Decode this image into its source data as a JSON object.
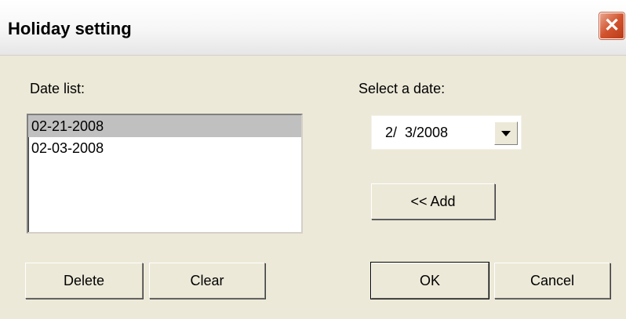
{
  "window": {
    "title": "Holiday setting",
    "close_glyph": "✕"
  },
  "date_list": {
    "label": "Date list:",
    "items": [
      {
        "text": "02-21-2008",
        "selected": true
      },
      {
        "text": "02-03-2008",
        "selected": false
      }
    ]
  },
  "date_picker": {
    "label": "Select a date:",
    "value": "2/  3/2008"
  },
  "buttons": {
    "add": "<< Add",
    "delete": "Delete",
    "clear": "Clear",
    "ok": "OK",
    "cancel": "Cancel"
  },
  "colors": {
    "dialog_bg": "#ece9d8",
    "close_button": "#d2542f",
    "selection": "#c0c0c0"
  }
}
